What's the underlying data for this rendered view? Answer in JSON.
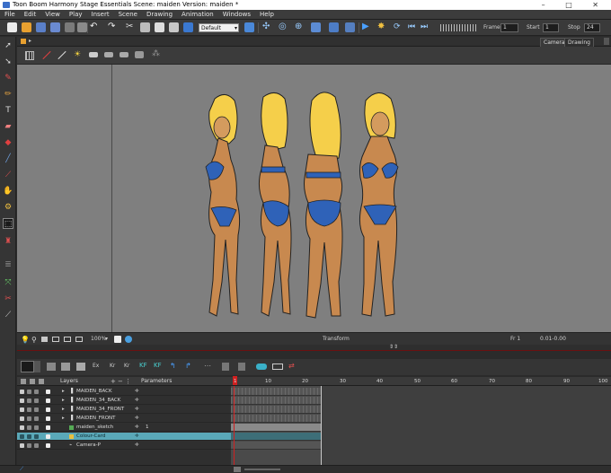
{
  "window": {
    "title": "Toon Boom Harmony Stage Essentials Scene: maiden Version: maiden *",
    "controls": [
      "–",
      "□",
      "✕"
    ]
  },
  "menu": [
    "File",
    "Edit",
    "View",
    "Play",
    "Insert",
    "Scene",
    "Drawing",
    "Animation",
    "Windows",
    "Help"
  ],
  "toolbar": {
    "workspace_value": "Default",
    "frame_label": "Frame",
    "frame_value": "1",
    "start_label": "Start",
    "start_value": "1",
    "stop_label": "Stop",
    "stop_value": "24"
  },
  "view_tabs": [
    "Camera",
    "Drawing"
  ],
  "view_status": {
    "zoom": "100%",
    "mode": "Transform",
    "frame": "Fr 1",
    "coords": "0.01-0.00"
  },
  "timeline": {
    "layers_label": "Layers",
    "parameters_label": "Parameters",
    "layers": [
      {
        "name": "MAIDEN_BACK",
        "selected": false
      },
      {
        "name": "MAIDEN_34_BACK",
        "selected": false
      },
      {
        "name": "MAIDEN_34_FRONT",
        "selected": false
      },
      {
        "name": "MAIDEN_FRONT",
        "selected": false
      },
      {
        "name": "maiden_sketch",
        "selected": false,
        "param": "1"
      },
      {
        "name": "Colour-Card",
        "selected": true
      },
      {
        "name": "Camera-P",
        "selected": false
      }
    ],
    "ruler_ticks": [
      "1",
      "10",
      "20",
      "30",
      "40",
      "50",
      "60",
      "70",
      "80",
      "90",
      "100"
    ]
  },
  "colors": {
    "accent": "#5aa8b8",
    "canvas": "#7f7f7f",
    "playhead": "#d02020"
  }
}
